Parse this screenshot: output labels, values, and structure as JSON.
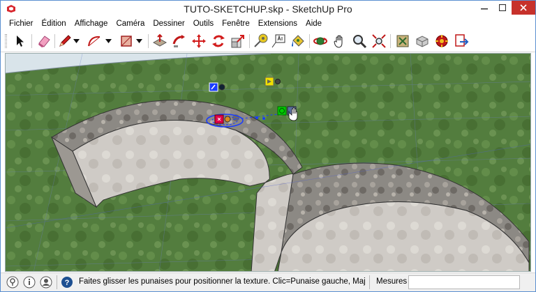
{
  "window": {
    "title": "TUTO-SKETCHUP.skp - SketchUp Pro"
  },
  "menu": {
    "items": [
      "Fichier",
      "Édition",
      "Affichage",
      "Caméra",
      "Dessiner",
      "Outils",
      "Fenêtre",
      "Extensions",
      "Aide"
    ]
  },
  "toolbar": {
    "tools": [
      "select-icon",
      "eraser-icon",
      "pencil-icon",
      "arc-icon",
      "rectangle-icon",
      "push-pull-icon",
      "follow-me-icon",
      "move-icon",
      "rotate-icon",
      "scale-icon",
      "tape-measure-icon",
      "text-icon",
      "paint-bucket-icon",
      "orbit-icon",
      "pan-icon",
      "zoom-icon",
      "zoom-extents-icon",
      "warehouse-icon",
      "components-icon",
      "extension-warehouse-icon",
      "send-to-layout-icon"
    ]
  },
  "texture_pins": {
    "red": "#e0004a",
    "green": "#00cc00",
    "blue": "#1a3cff",
    "yellow": "#f0e000"
  },
  "statusbar": {
    "message": "Faites glisser les punaises pour positionner la texture.  Clic=Punaise gauche, Maj=Ba...",
    "measures_label": "Mesures",
    "measures_value": ""
  },
  "colors": {
    "window_border": "#5a8fd0",
    "close_button": "#c7312b",
    "grass": "#4f7a3a",
    "stone": "#8a8580"
  }
}
